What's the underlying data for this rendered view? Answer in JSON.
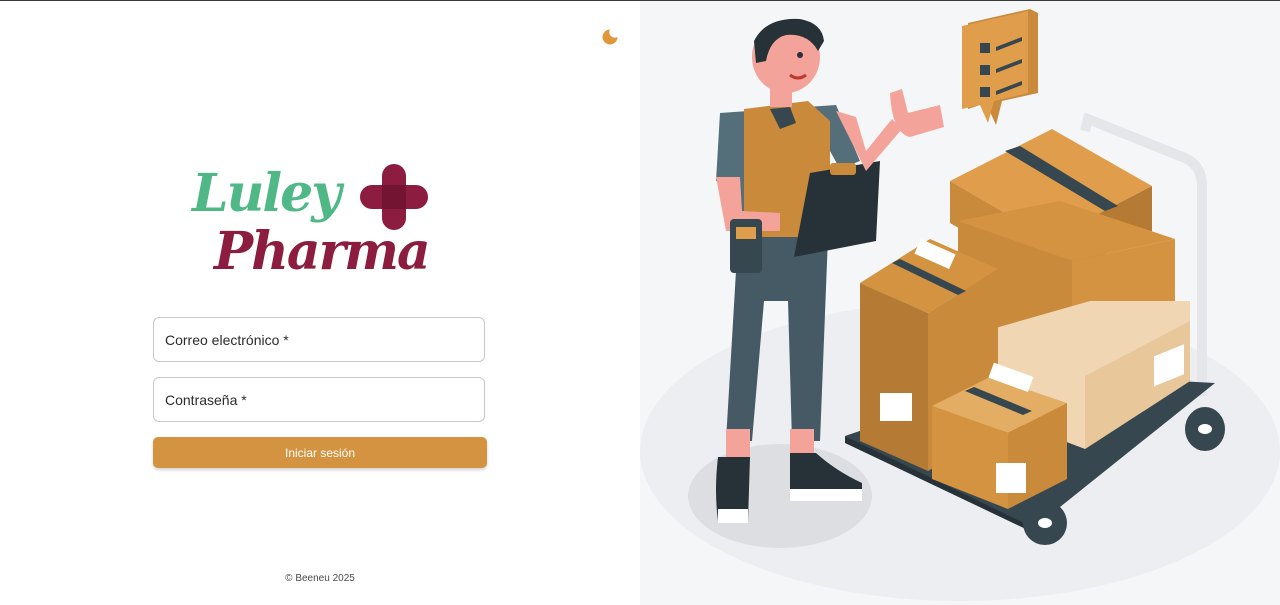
{
  "brand": {
    "logo_line1": "Luley",
    "logo_line2": "Pharma",
    "colors": {
      "green": "#4fb886",
      "maroon": "#8c1c40",
      "accent": "#d49340"
    }
  },
  "theme_toggle": {
    "icon": "moon-icon"
  },
  "form": {
    "email_label": "Correo electrónico  *",
    "password_label": "Contraseña  *",
    "submit_label": "Iniciar sesión"
  },
  "footer": {
    "copyright": "© Beeneu 2025"
  }
}
